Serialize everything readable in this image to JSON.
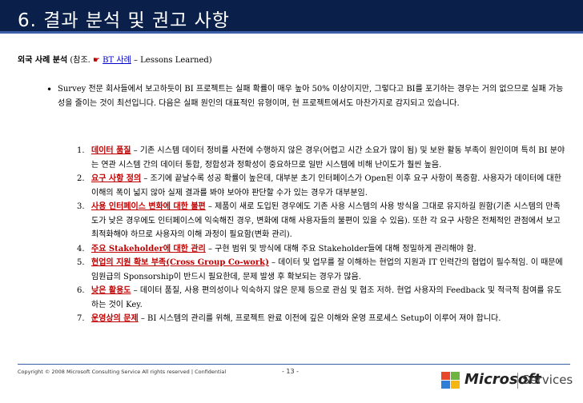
{
  "header": {
    "title": "6. 결과 분석 및 권고 사항"
  },
  "subhead": {
    "label": "외국 사례 분석",
    "open": " (참조.",
    "pointer": " ☛ ",
    "link": "BT 사례",
    "rest": " – Lessons Learned)"
  },
  "intro": "Survey 전문 회사들에서 보고하듯이 BI 프로젝트는 실패 확률이 매우 높아 50% 이상이지만, 그렇다고 BI를 포기하는 경우는 거의 없으므로 실패 가능성을 줄이는 것이 최선입니다. 다음은 실패 원인의 대표적인 유형이며, 현 프로젝트에서도 마찬가지로 감지되고 있습니다.",
  "items": [
    {
      "num": "1.",
      "label": "데이터 품질",
      "text": " – 기존 시스템 데이터 정비를 사전에 수행하지 않은 경우(어렵고 시간 소요가 많이 됨) 및 보완 활동 부족이 원인이며 특히 BI 분야는 연관 시스템 간의 데이터 통합, 정합성과 정확성이 중요하므로 일반 시스템에 비해 난이도가 훨씬 높음."
    },
    {
      "num": "2.",
      "label": "요구 사항 정의",
      "text": " – 조기에 끝날수록 성공 확률이 높은데, 대부분 초기 인터페이스가 Open된 이후 요구 사항이 폭증함. 사용자가 데이터에 대한 이해의 폭이 넓지 않아 실제 결과를 봐야 보아야 판단할 수가 있는 경우가 대부분임."
    },
    {
      "num": "3.",
      "label": "사용 인터페이스 변화에 대한 불편",
      "text": " – 제품이 새로 도입된 경우에도 기존 사용 시스템의 사용 방식을 그대로 유지하길 원함(기존 시스템의 만족도가 낮은 경우에도 인터페이스에 익숙해진 경우, 변화에 대해 사용자들의 불편이 있을 수 있음). 또한 각 요구 사항은 전체적인 관점에서 보고 최적화해야 하므로 사용자의 이해 과정이 필요함(변화 관리)."
    },
    {
      "num": "4.",
      "label": "주요 Stakeholder에 대한 관리",
      "text": " – 구현 범위 및 방식에 대해 주요 Stakeholder들에 대해 정밀하게 관리해야 함."
    },
    {
      "num": "5.",
      "label": "현업의 지원 확보 부족(Cross Group Co-work)",
      "text": " – 데이터 및 업무를 잘 이해하는 현업의 지원과 IT 인력간의 협업이 필수적임. 이 때문에 임원급의 Sponsorship이 반드시 필요한데, 문제 발생 후 확보되는 경우가 많음."
    },
    {
      "num": "6.",
      "label": "낮은 활용도",
      "text": " – 데이터 품질, 사용 편의성이나 익숙하지 않은 문제 등으로 관심 및 협조 저하. 현업 사용자의 Feedback 및 적극적 참여를 유도하는 것이 Key."
    },
    {
      "num": "7.",
      "label": "운영상의 문제",
      "text": " – BI 시스템의 관리를 위해, 프로젝트 완료 이전에 깊은 이해와 운영 프로세스 Setup이 이루어 져야 합니다."
    }
  ],
  "footer": {
    "copyright": "Copyright © 2008 Microsoft Consulting Service All rights reserved  |  Confidential",
    "page": "- 13 -",
    "logo_brand": "Microsoft",
    "logo_division": "Services"
  },
  "colors": {
    "title_bar": "#0a1f4a",
    "accent": "#3a5fa8",
    "label_red": "#c00000"
  }
}
